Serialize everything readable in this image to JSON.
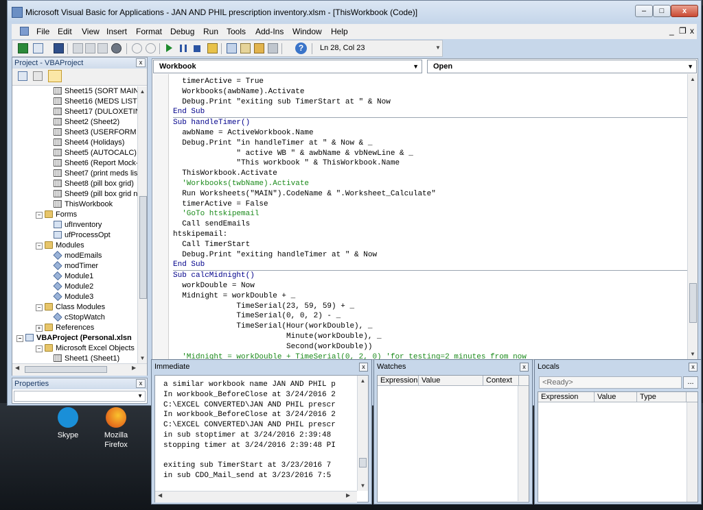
{
  "window": {
    "title": "Microsoft Visual Basic for Applications - JAN AND PHIL prescription inventory.xlsm - [ThisWorkbook (Code)]",
    "controls": [
      "–",
      "□",
      "x"
    ],
    "doc_controls": [
      "_",
      "❐",
      "x"
    ]
  },
  "menu": [
    "File",
    "Edit",
    "View",
    "Insert",
    "Format",
    "Debug",
    "Run",
    "Tools",
    "Add-Ins",
    "Window",
    "Help"
  ],
  "toolbar": {
    "position": "Ln 28, Col 23"
  },
  "project": {
    "title": "Project - VBAProject",
    "items": [
      {
        "label": "Sheet15 (SORT MAIN)",
        "icon": "sheet-icon",
        "indent": 3
      },
      {
        "label": "Sheet16 (MEDS LIST)",
        "icon": "sheet-icon",
        "indent": 3
      },
      {
        "label": "Sheet17 (DULOXETINE",
        "icon": "sheet-icon",
        "indent": 3
      },
      {
        "label": "Sheet2 (Sheet2)",
        "icon": "sheet-icon",
        "indent": 3
      },
      {
        "label": "Sheet3 (USERFORM D",
        "icon": "sheet-icon",
        "indent": 3
      },
      {
        "label": "Sheet4 (Holidays)",
        "icon": "sheet-icon",
        "indent": 3
      },
      {
        "label": "Sheet5 (AUTOCALC)",
        "icon": "sheet-icon",
        "indent": 3
      },
      {
        "label": "Sheet6 (Report Mock-u",
        "icon": "sheet-icon",
        "indent": 3
      },
      {
        "label": "Sheet7 (print meds list",
        "icon": "sheet-icon",
        "indent": 3
      },
      {
        "label": "Sheet8 (pill box grid)",
        "icon": "sheet-icon",
        "indent": 3
      },
      {
        "label": "Sheet9 (pill box grid nc",
        "icon": "sheet-icon",
        "indent": 3
      },
      {
        "label": "ThisWorkbook",
        "icon": "workbook-icon",
        "indent": 3
      },
      {
        "label": "Forms",
        "icon": "folder-icon",
        "indent": 2,
        "expander": "−"
      },
      {
        "label": "ufInventory",
        "icon": "form-icon",
        "indent": 3
      },
      {
        "label": "ufProcessOpt",
        "icon": "form-icon",
        "indent": 3
      },
      {
        "label": "Modules",
        "icon": "folder-icon",
        "indent": 2,
        "expander": "−"
      },
      {
        "label": "modEmails",
        "icon": "module-icon",
        "indent": 3
      },
      {
        "label": "modTimer",
        "icon": "module-icon",
        "indent": 3
      },
      {
        "label": "Module1",
        "icon": "module-icon",
        "indent": 3
      },
      {
        "label": "Module2",
        "icon": "module-icon",
        "indent": 3
      },
      {
        "label": "Module3",
        "icon": "module-icon",
        "indent": 3
      },
      {
        "label": "Class Modules",
        "icon": "folder-icon",
        "indent": 2,
        "expander": "−"
      },
      {
        "label": "cStopWatch",
        "icon": "class-icon",
        "indent": 3
      },
      {
        "label": "References",
        "icon": "folder-icon",
        "indent": 2,
        "expander": "+"
      },
      {
        "label": "VBAProject (Personal.xlsn",
        "icon": "project-icon",
        "indent": 0,
        "expander": "−",
        "bold": true
      },
      {
        "label": "Microsoft Excel Objects",
        "icon": "folder-icon",
        "indent": 2,
        "expander": "−"
      },
      {
        "label": "Sheet1 (Sheet1)",
        "icon": "sheet-icon",
        "indent": 3
      }
    ]
  },
  "properties": {
    "title": "Properties"
  },
  "code": {
    "object_combo": "Workbook",
    "proc_combo": "Open",
    "lines": [
      {
        "text": "  timerActive = True",
        "t": "n"
      },
      {
        "text": "  Workbooks(awbName).Activate",
        "t": "n"
      },
      {
        "text": "  Debug.Print \"exiting sub TimerStart at \" & Now",
        "t": "n"
      },
      {
        "text": "End Sub",
        "t": "k"
      },
      {
        "text": "Sub handleTimer()",
        "t": "k",
        "sep": true
      },
      {
        "text": "  awbName = ActiveWorkbook.Name",
        "t": "n"
      },
      {
        "text": "  Debug.Print \"in handleTimer at \" & Now & _",
        "t": "n"
      },
      {
        "text": "              \" active WB \" & awbName & vbNewLine & _",
        "t": "n"
      },
      {
        "text": "              \"This workbook \" & ThisWorkbook.Name",
        "t": "n"
      },
      {
        "text": "  ThisWorkbook.Activate",
        "t": "n"
      },
      {
        "text": "  'Workbooks(twbName).Activate",
        "t": "c"
      },
      {
        "text": "  Run Worksheets(\"MAIN\").CodeName & \".Worksheet_Calculate\"",
        "t": "n"
      },
      {
        "text": "  timerActive = False",
        "t": "n"
      },
      {
        "text": "  'GoTo htskipemail",
        "t": "c"
      },
      {
        "text": "  Call sendEmails",
        "t": "n"
      },
      {
        "text": "htskipemail:",
        "t": "n"
      },
      {
        "text": "  Call TimerStart",
        "t": "n"
      },
      {
        "text": "  Debug.Print \"exiting handleTimer at \" & Now",
        "t": "n"
      },
      {
        "text": "End Sub",
        "t": "k"
      },
      {
        "text": "Sub calcMidnight()",
        "t": "k",
        "sep": true
      },
      {
        "text": "  workDouble = Now",
        "t": "n"
      },
      {
        "text": "  Midnight = workDouble + _",
        "t": "n"
      },
      {
        "text": "              TimeSerial(23, 59, 59) + _",
        "t": "n"
      },
      {
        "text": "              TimeSerial(0, 0, 2) - _",
        "t": "n"
      },
      {
        "text": "              TimeSerial(Hour(workDouble), _",
        "t": "n"
      },
      {
        "text": "                         Minute(workDouble), _",
        "t": "n"
      },
      {
        "text": "                         Second(workDouble))",
        "t": "n"
      },
      {
        "text": "  'Midnight = workDouble + TimeSerial(0, 2, 0) 'for testing=2 minutes from now",
        "t": "c"
      }
    ]
  },
  "immediate": {
    "title": "Immediate",
    "lines": [
      "a similar workbook name JAN AND PHIL p",
      "In workbook_BeforeClose at 3/24/2016 2",
      "C:\\EXCEL CONVERTED\\JAN AND PHIL prescr",
      "In workbook_BeforeClose at 3/24/2016 2",
      "C:\\EXCEL CONVERTED\\JAN AND PHIL prescr",
      "in sub stoptimer at 3/24/2016 2:39:48",
      "stopping timer at 3/24/2016 2:39:48 PI",
      "",
      "exiting sub TimerStart at 3/23/2016 7",
      "in sub CDO_Mail_send at 3/23/2016 7:5"
    ]
  },
  "watches": {
    "title": "Watches",
    "columns": [
      "Expression",
      "Value",
      "Context"
    ]
  },
  "locals": {
    "title": "Locals",
    "status": "<Ready>",
    "columns": [
      "Expression",
      "Value",
      "Type"
    ],
    "button": "..."
  },
  "desktop": [
    {
      "label": "Skype",
      "color": "#1a8fd8"
    },
    {
      "label": "Mozilla\nFirefox",
      "color": "#e8761e"
    }
  ]
}
